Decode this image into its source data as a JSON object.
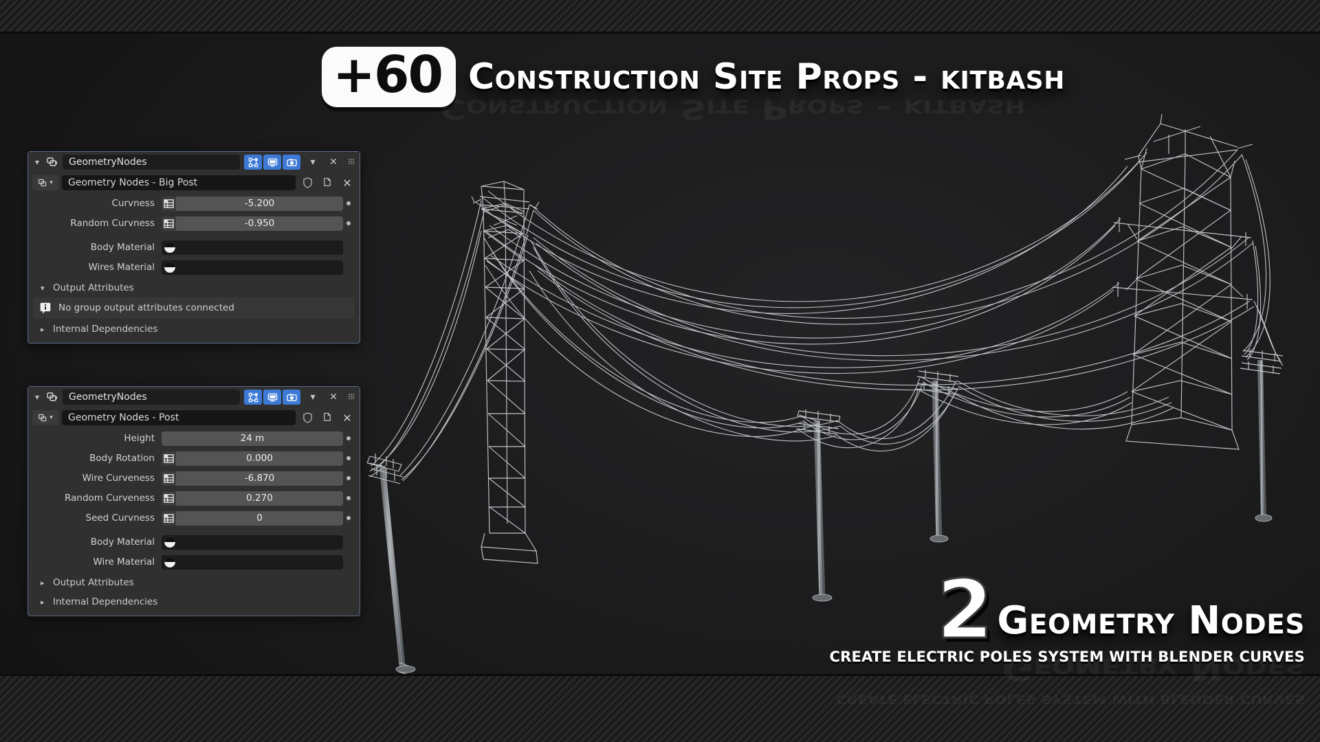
{
  "promo": {
    "badge": "+60",
    "headline": "Construction Site Props - kitbash",
    "callout_number": "2",
    "callout_title": "Geometry Nodes",
    "callout_subtitle": "CREATE ELECTRIC POLES SYSTEM WITH BLENDER CURVES"
  },
  "panels": [
    {
      "id": "bigpost",
      "modifier_name": "GeometryNodes",
      "node_group_name": "Geometry Nodes - Big Post",
      "toggles": [
        {
          "name": "edit-mode-display-toggle",
          "icon": "node-editor-icon",
          "on": true
        },
        {
          "name": "realtime-display-toggle",
          "icon": "monitor-icon",
          "on": true
        },
        {
          "name": "render-display-toggle",
          "icon": "camera-icon",
          "on": true
        }
      ],
      "header_buttons": [
        "chevron-down-icon",
        "close-icon",
        "grip-icon"
      ],
      "node_buttons": [
        "shield-icon",
        "duplicate-icon",
        "close-icon"
      ],
      "properties": [
        {
          "label": "Curvness",
          "value": "-5.200",
          "widget": "slider-spreadsheet",
          "dot": true
        },
        {
          "label": "Random Curvness",
          "value": "-0.950",
          "widget": "slider-spreadsheet",
          "dot": true
        },
        {
          "label": "Body Material",
          "value": "",
          "widget": "material",
          "dot": false
        },
        {
          "label": "Wires Material",
          "value": "",
          "widget": "material",
          "dot": false
        }
      ],
      "sections": [
        {
          "label": "Output Attributes",
          "expanded": true
        },
        {
          "label": "Internal Dependencies",
          "expanded": false
        }
      ],
      "info_message": "No group output attributes connected"
    },
    {
      "id": "post",
      "modifier_name": "GeometryNodes",
      "node_group_name": "Geometry Nodes - Post",
      "toggles": [
        {
          "name": "edit-mode-display-toggle",
          "icon": "node-editor-icon",
          "on": true
        },
        {
          "name": "realtime-display-toggle",
          "icon": "monitor-icon",
          "on": true
        },
        {
          "name": "render-display-toggle",
          "icon": "camera-icon",
          "on": true
        }
      ],
      "header_buttons": [
        "chevron-down-icon",
        "close-icon",
        "grip-icon"
      ],
      "node_buttons": [
        "shield-icon",
        "duplicate-icon",
        "close-icon"
      ],
      "properties": [
        {
          "label": "Height",
          "value": "24 m",
          "widget": "slider",
          "dot": true
        },
        {
          "label": "Body Rotation",
          "value": "0.000",
          "widget": "slider-spreadsheet",
          "dot": true
        },
        {
          "label": "Wire Curveness",
          "value": "-6.870",
          "widget": "slider-spreadsheet",
          "dot": true
        },
        {
          "label": "Random Curveness",
          "value": "0.270",
          "widget": "slider-spreadsheet",
          "dot": true
        },
        {
          "label": "Seed Curvness",
          "value": "0",
          "widget": "slider-spreadsheet",
          "dot": true
        },
        {
          "label": "Body Material",
          "value": "",
          "widget": "material",
          "dot": false
        },
        {
          "label": "Wire Material",
          "value": "",
          "widget": "material",
          "dot": false
        }
      ],
      "sections": [
        {
          "label": "Output Attributes",
          "expanded": false
        },
        {
          "label": "Internal Dependencies",
          "expanded": false
        }
      ],
      "info_message": ""
    }
  ],
  "colors": {
    "accent_blue": "#3d7ad6",
    "panel_bg": "#303030",
    "panel_border": "#5a6b86",
    "field_bg": "#545454",
    "dark_field": "#1d1d1d",
    "viewport_bg": "#1b1b1c",
    "text": "#d2d2d2"
  }
}
